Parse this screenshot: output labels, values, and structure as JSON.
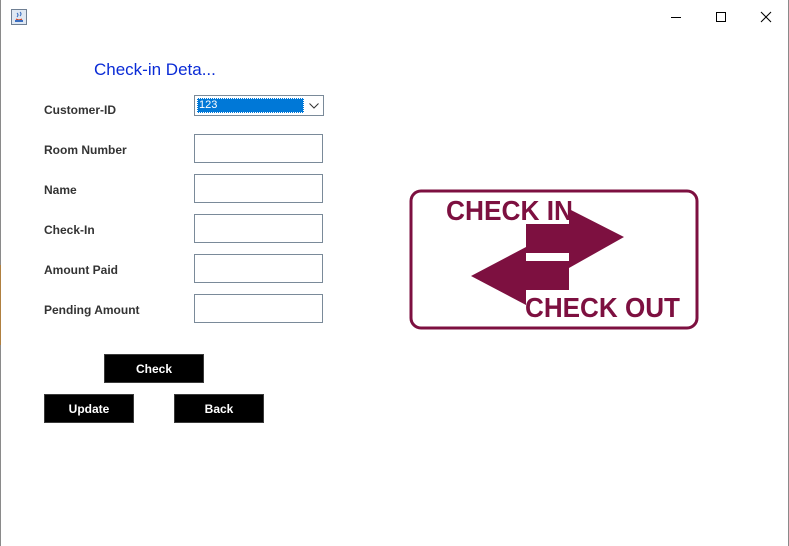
{
  "window": {
    "controls": {
      "minimize_icon": "minimize-icon",
      "maximize_icon": "maximize-icon",
      "close_icon": "close-icon"
    }
  },
  "form": {
    "title": "Check-in Deta...",
    "fields": {
      "customer_id": {
        "label": "Customer-ID",
        "selected": "123"
      },
      "room_number": {
        "label": "Room Number",
        "value": ""
      },
      "name": {
        "label": "Name",
        "value": ""
      },
      "check_in": {
        "label": "Check-In",
        "value": ""
      },
      "amount_paid": {
        "label": "Amount Paid",
        "value": ""
      },
      "pending_amount": {
        "label": "Pending Amount",
        "value": ""
      }
    },
    "buttons": {
      "check": "Check",
      "update": "Update",
      "back": "Back"
    }
  },
  "logo": {
    "top_text": "CHECK IN",
    "bottom_text": "CHECK OUT",
    "color": "#7d1040"
  },
  "colors": {
    "title_blue": "#0a2bd6",
    "button_bg": "#000000",
    "selection_blue": "#0078d7"
  }
}
